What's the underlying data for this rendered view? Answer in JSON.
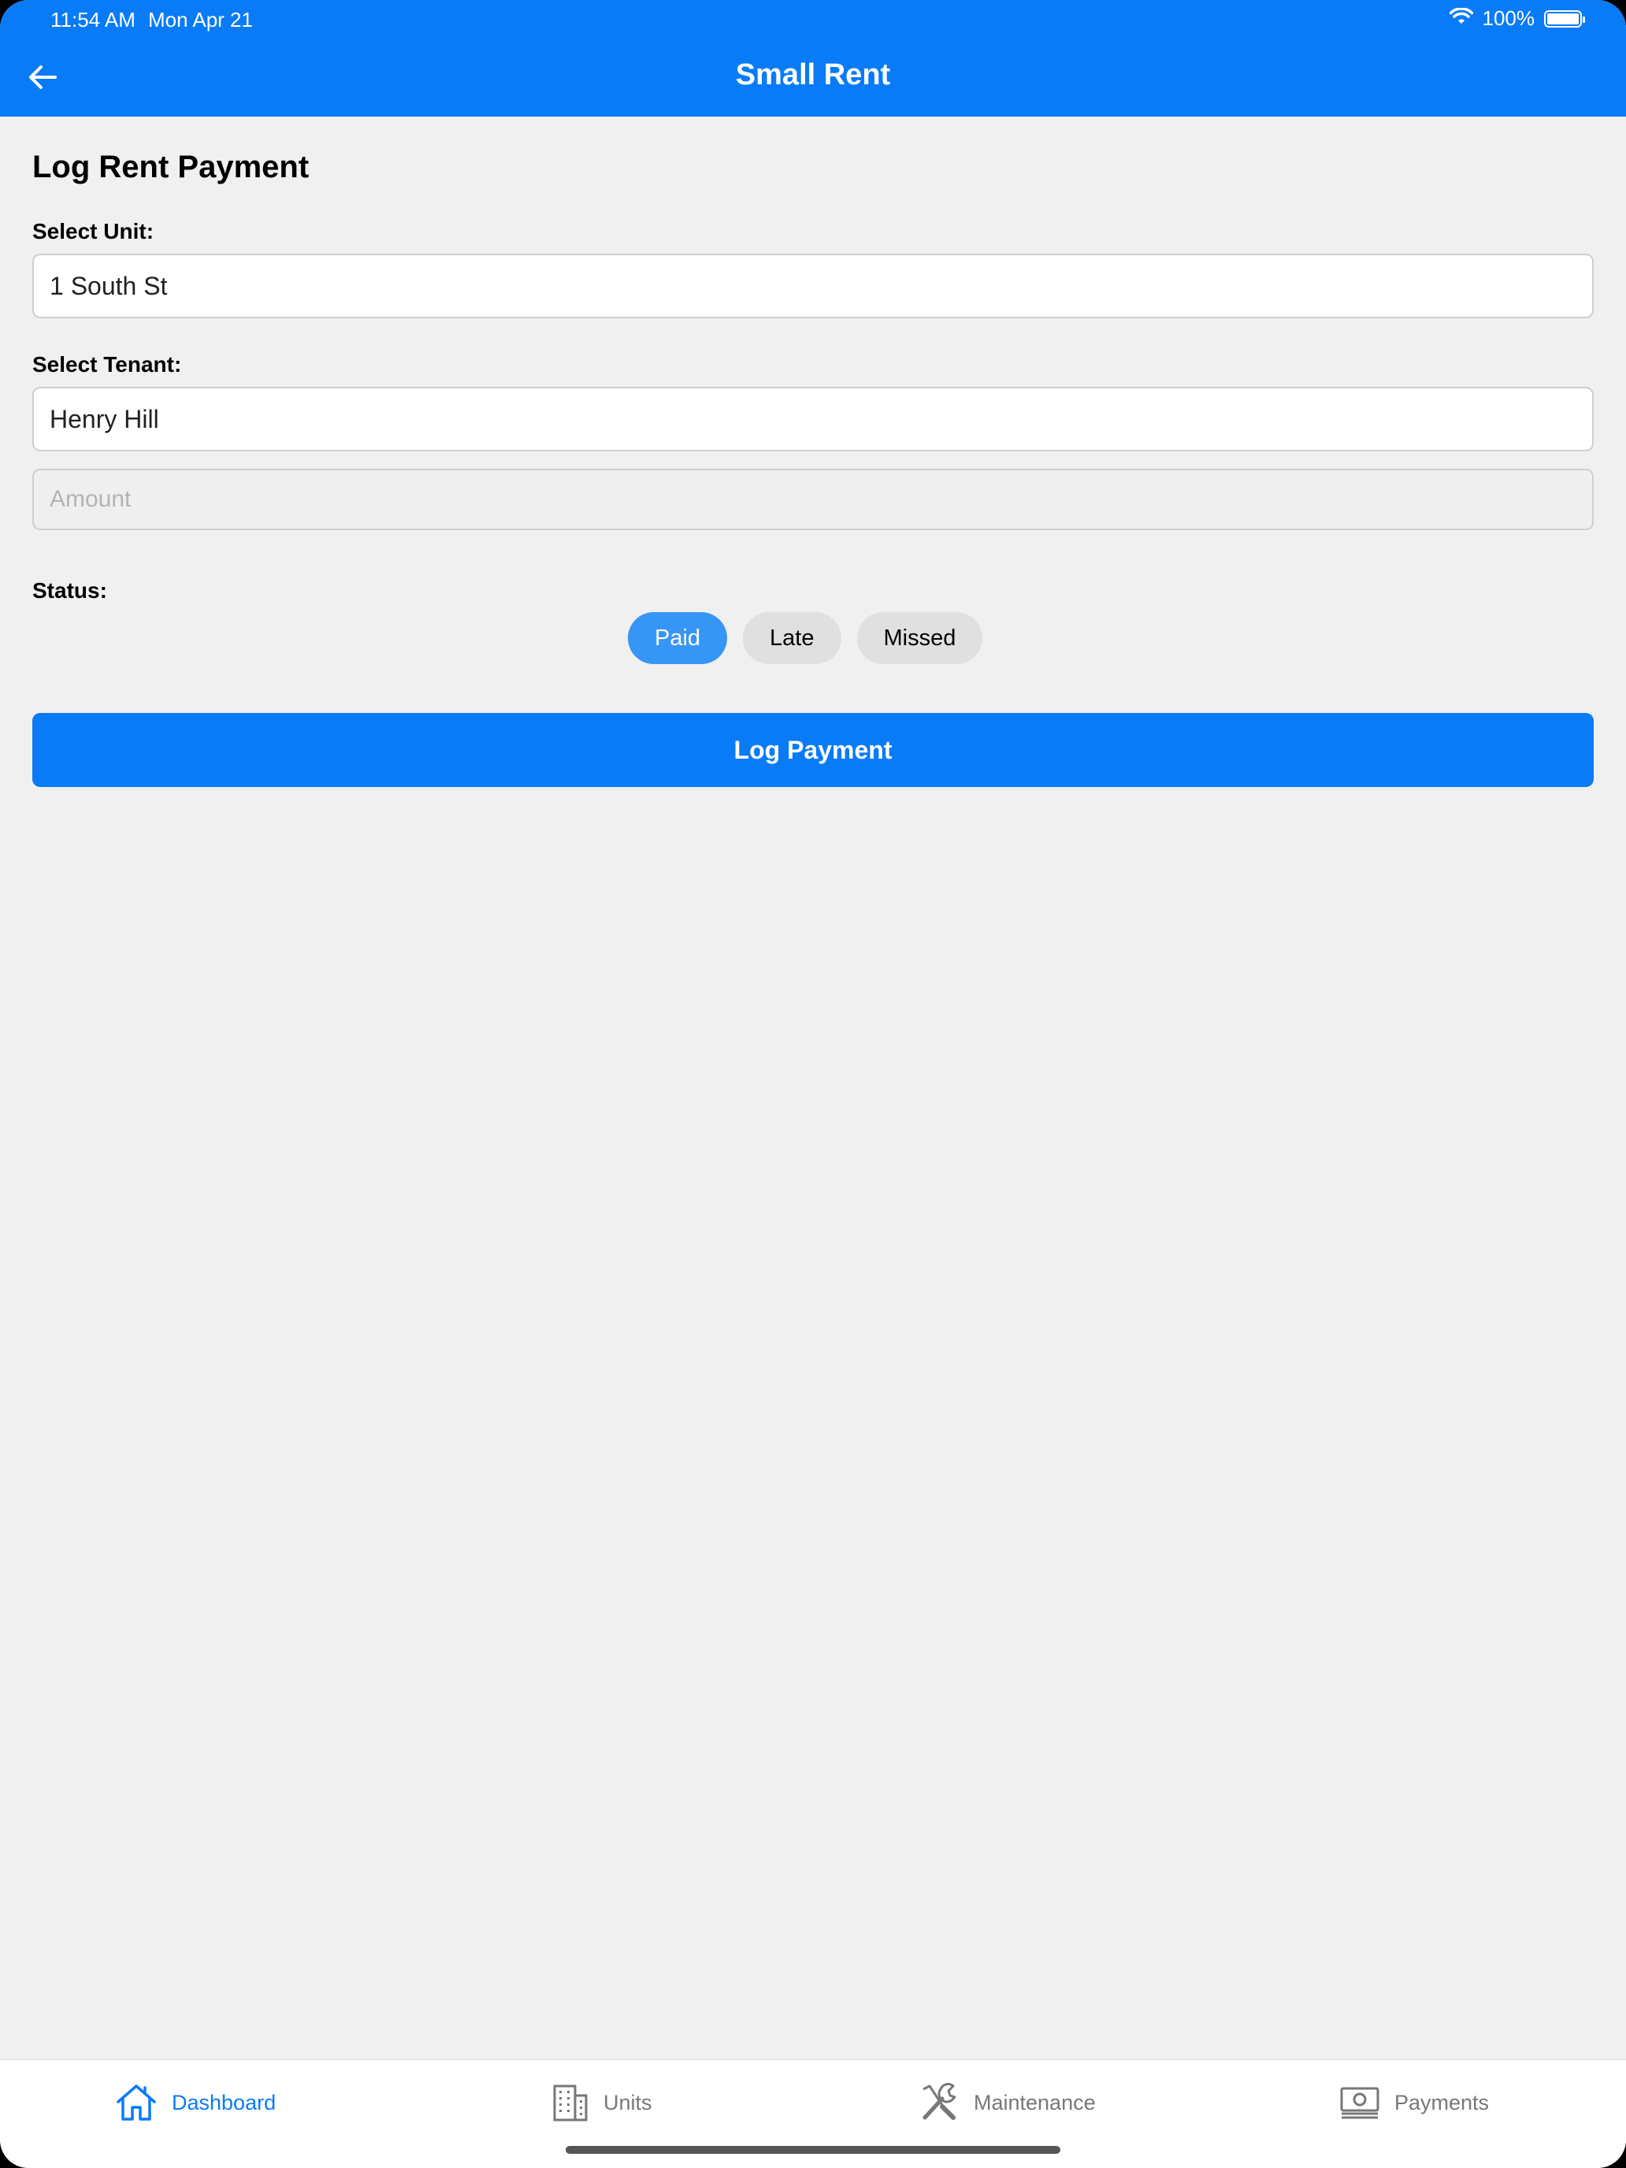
{
  "status_bar": {
    "time": "11:54 AM",
    "date": "Mon Apr 21",
    "battery": "100%"
  },
  "header": {
    "title": "Small Rent",
    "back_icon": "arrow-left-icon"
  },
  "form": {
    "title": "Log Rent Payment",
    "unit_label": "Select Unit:",
    "unit_value": "1 South St",
    "tenant_label": "Select Tenant:",
    "tenant_value": "Henry Hill",
    "amount_placeholder": "Amount",
    "amount_value": "",
    "status_label": "Status:",
    "status_options": [
      "Paid",
      "Late",
      "Missed"
    ],
    "selected_status": "Paid",
    "submit_label": "Log Payment"
  },
  "tabbar": {
    "items": [
      {
        "label": "Dashboard",
        "icon": "home-icon",
        "active": true
      },
      {
        "label": "Units",
        "icon": "building-icon",
        "active": false
      },
      {
        "label": "Maintenance",
        "icon": "tools-icon",
        "active": false
      },
      {
        "label": "Payments",
        "icon": "cash-icon",
        "active": false
      }
    ]
  },
  "colors": {
    "primary": "#0a7bf7",
    "active_pill": "#3796f5",
    "inactive_pill": "#e0e0e0",
    "background": "#f0f0f0",
    "inactive_tab": "#777777"
  }
}
